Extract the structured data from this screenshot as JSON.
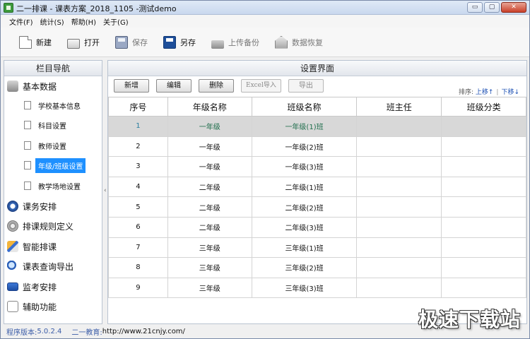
{
  "window": {
    "title": "二一排课 - 课表方案_2018_1105 -测试demo",
    "controls": [
      "▭",
      "▢",
      "✕"
    ]
  },
  "menu": [
    "文件(F)",
    "统计(S)",
    "帮助(H)",
    "关于(G)"
  ],
  "toolbar": [
    {
      "label": "新建",
      "icon": "new-doc-icon",
      "enabled": true
    },
    {
      "label": "打开",
      "icon": "open-folder-icon",
      "enabled": true
    },
    {
      "label": "保存",
      "icon": "save-icon",
      "enabled": false
    },
    {
      "label": "另存",
      "icon": "save-as-icon",
      "enabled": true
    },
    {
      "label": "上传备份",
      "icon": "upload-backup-icon",
      "enabled": false
    },
    {
      "label": "数据恢复",
      "icon": "restore-icon",
      "enabled": false
    }
  ],
  "nav": {
    "title": "栏目导航",
    "basic_group": "基本数据",
    "sub_items": [
      "学校基本信息",
      "科目设置",
      "教师设置",
      "年级/班级设置",
      "教学场地设置"
    ],
    "selected_sub": "年级/班级设置",
    "groups": [
      "课务安排",
      "排课规则定义",
      "智能排课",
      "课表查询导出",
      "监考安排",
      "辅助功能"
    ],
    "collapse_glyph": "‹"
  },
  "main": {
    "title": "设置界面",
    "actions": [
      {
        "label": "新增",
        "enabled": true
      },
      {
        "label": "编辑",
        "enabled": true
      },
      {
        "label": "删除",
        "enabled": true
      },
      {
        "label": "Excel导入",
        "enabled": false
      },
      {
        "label": "导出",
        "enabled": false
      }
    ],
    "sort": {
      "label": "排序:",
      "up": "上移↑",
      "sep": "|",
      "down": "下移↓"
    },
    "columns": [
      "序号",
      "年级名称",
      "班级名称",
      "班主任",
      "班级分类"
    ],
    "rows": [
      [
        "1",
        "一年级",
        "一年级(1)班",
        "",
        ""
      ],
      [
        "2",
        "一年级",
        "一年级(2)班",
        "",
        ""
      ],
      [
        "3",
        "一年级",
        "一年级(3)班",
        "",
        ""
      ],
      [
        "4",
        "二年级",
        "二年级(1)班",
        "",
        ""
      ],
      [
        "5",
        "二年级",
        "二年级(2)班",
        "",
        ""
      ],
      [
        "6",
        "二年级",
        "二年级(3)班",
        "",
        ""
      ],
      [
        "7",
        "三年级",
        "三年级(1)班",
        "",
        ""
      ],
      [
        "8",
        "三年级",
        "三年级(2)班",
        "",
        ""
      ],
      [
        "9",
        "三年级",
        "三年级(3)班",
        "",
        ""
      ]
    ],
    "selected_row": 1
  },
  "status": {
    "version_label": "程序版本:",
    "version": "5.0.2.4",
    "site_label": "二一教育:",
    "site": "http://www.21cnjy.com/"
  },
  "watermark": "极速下载站",
  "colors": {
    "selection": "#1e90ff",
    "link": "#1b4fb3",
    "status_text": "#3a5ca8"
  }
}
